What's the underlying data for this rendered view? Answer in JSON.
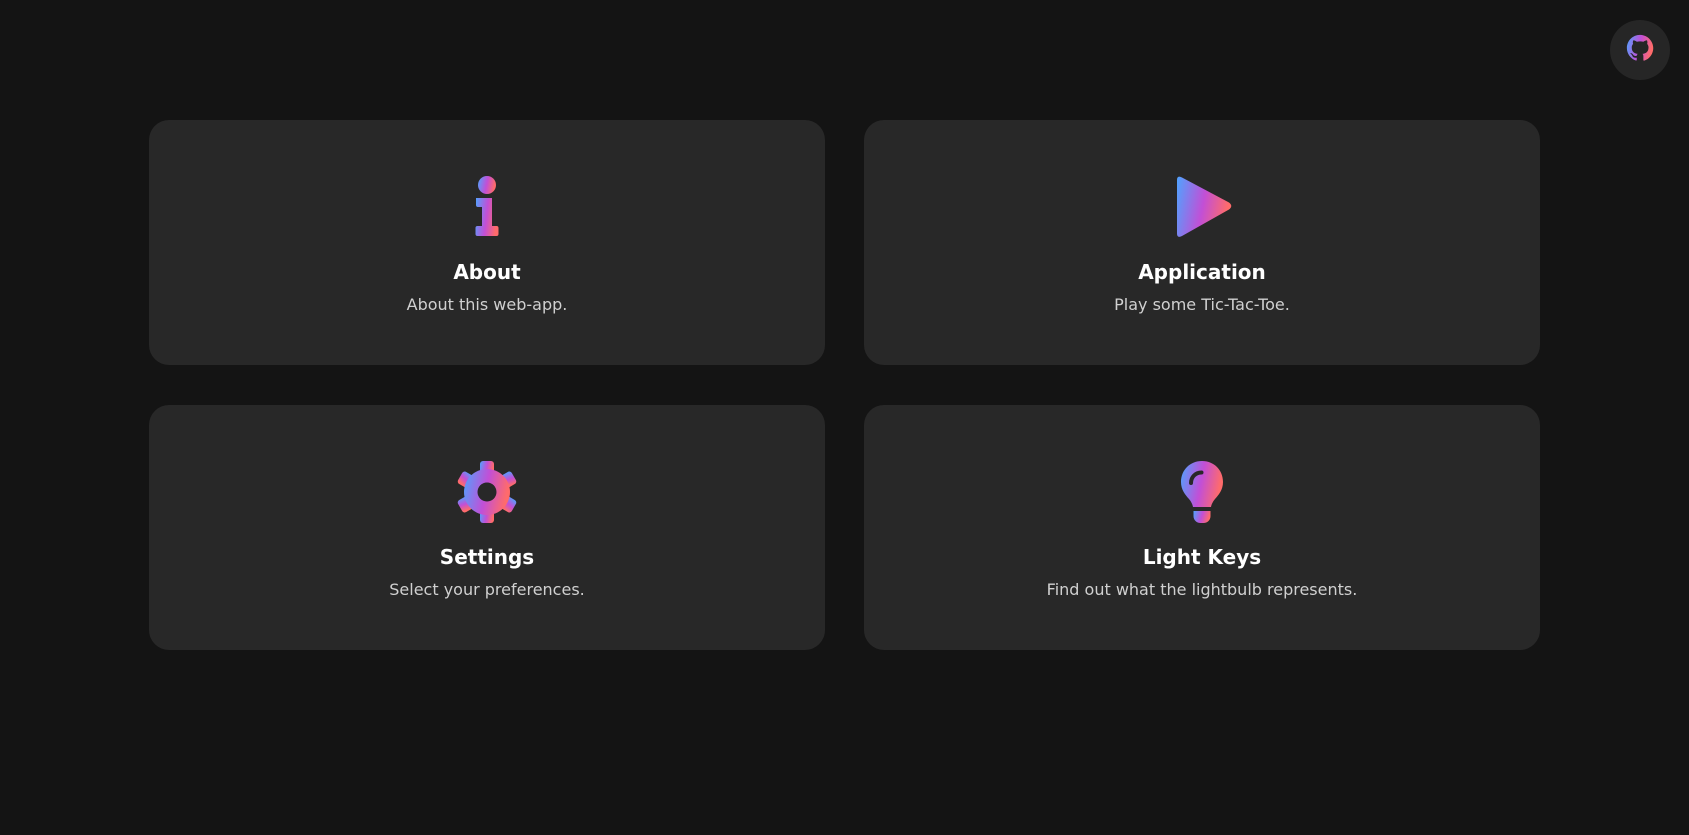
{
  "header": {
    "github_icon": "github-icon"
  },
  "colors": {
    "background": "#141414",
    "card": "#282828",
    "gradient_start": "#4fa3ff",
    "gradient_mid": "#c24fd6",
    "gradient_end": "#ff6b6b"
  },
  "cards": [
    {
      "icon": "info-icon",
      "title": "About",
      "description": "About this web-app."
    },
    {
      "icon": "play-icon",
      "title": "Application",
      "description": "Play some Tic-Tac-Toe."
    },
    {
      "icon": "gear-icon",
      "title": "Settings",
      "description": "Select your preferences."
    },
    {
      "icon": "lightbulb-icon",
      "title": "Light Keys",
      "description": "Find out what the lightbulb represents."
    }
  ]
}
